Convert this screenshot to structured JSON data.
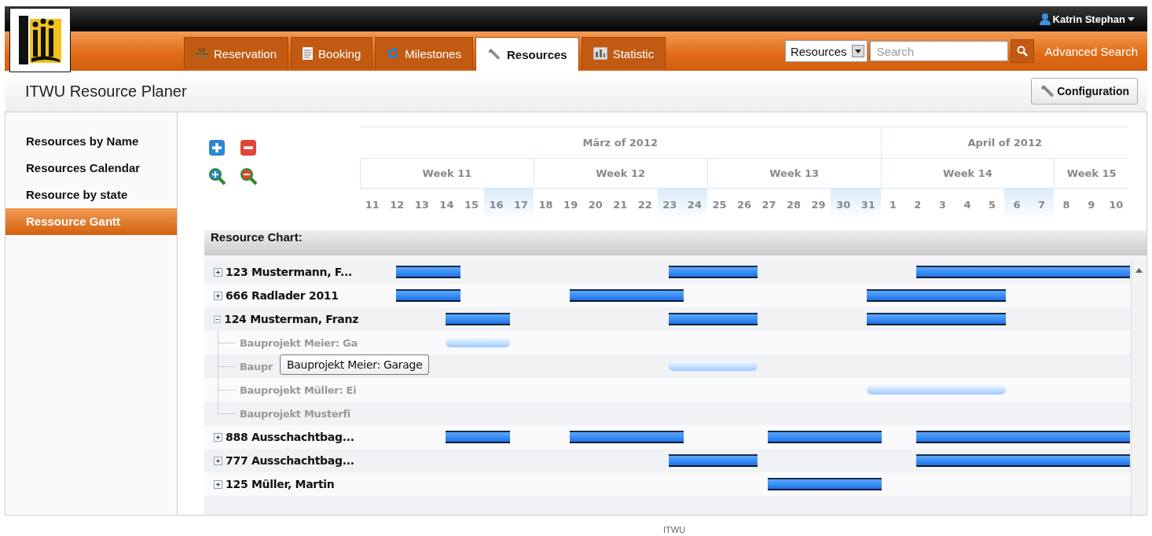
{
  "user": {
    "name": "Katrin Stephan"
  },
  "tabs": [
    {
      "label": "Reservation",
      "selected": false
    },
    {
      "label": "Booking",
      "selected": false
    },
    {
      "label": "Milestones",
      "selected": false
    },
    {
      "label": "Resources",
      "selected": true
    },
    {
      "label": "Statistic",
      "selected": false
    }
  ],
  "search": {
    "scope": "Resources",
    "placeholder": "Search",
    "advanced_link": "Advanced Search"
  },
  "page_title": "ITWU Resource Planer",
  "configuration_button": "Configuration",
  "sidebar": {
    "items": [
      {
        "label": "Resources by Name",
        "selected": false
      },
      {
        "label": "Resources Calendar",
        "selected": false
      },
      {
        "label": "Resource by state",
        "selected": false
      },
      {
        "label": "Ressource Gantt",
        "selected": true
      }
    ]
  },
  "gantt": {
    "months": [
      "März of 2012",
      "April of 2012"
    ],
    "weeks": [
      "Week 11",
      "Week 12",
      "Week 13",
      "Week 14",
      "Week 15"
    ],
    "days": [
      {
        "label": "11",
        "weekend": false
      },
      {
        "label": "12",
        "weekend": false
      },
      {
        "label": "13",
        "weekend": false
      },
      {
        "label": "14",
        "weekend": false
      },
      {
        "label": "15",
        "weekend": false
      },
      {
        "label": "16",
        "weekend": true
      },
      {
        "label": "17",
        "weekend": true
      },
      {
        "label": "18",
        "weekend": false
      },
      {
        "label": "19",
        "weekend": false
      },
      {
        "label": "20",
        "weekend": false
      },
      {
        "label": "21",
        "weekend": false
      },
      {
        "label": "22",
        "weekend": false
      },
      {
        "label": "23",
        "weekend": true
      },
      {
        "label": "24",
        "weekend": true
      },
      {
        "label": "25",
        "weekend": false
      },
      {
        "label": "26",
        "weekend": false
      },
      {
        "label": "27",
        "weekend": false
      },
      {
        "label": "28",
        "weekend": false
      },
      {
        "label": "29",
        "weekend": false
      },
      {
        "label": "30",
        "weekend": true
      },
      {
        "label": "31",
        "weekend": true
      },
      {
        "label": "1",
        "weekend": false
      },
      {
        "label": "2",
        "weekend": false
      },
      {
        "label": "3",
        "weekend": false
      },
      {
        "label": "4",
        "weekend": false
      },
      {
        "label": "5",
        "weekend": false
      },
      {
        "label": "6",
        "weekend": true
      },
      {
        "label": "7",
        "weekend": true
      },
      {
        "label": "8",
        "weekend": false
      },
      {
        "label": "9",
        "weekend": false
      },
      {
        "label": "10",
        "weekend": false
      }
    ],
    "chart_title": "Resource Chart:",
    "rows": [
      {
        "label": "123 Mustermann, F...",
        "expanded": false
      },
      {
        "label": "666 Radlader 2011",
        "expanded": false
      },
      {
        "label": "124 Musterman, Franz",
        "expanded": true,
        "children": [
          {
            "label": "Bauprojekt Meier: Ga"
          },
          {
            "label": "Baupr"
          },
          {
            "label": "Bauprojekt Müller: Ei"
          },
          {
            "label": "Bauprojekt Musterfi"
          }
        ]
      },
      {
        "label": "888 Ausschachtbag...",
        "expanded": false
      },
      {
        "label": "777 Ausschachtbag...",
        "expanded": false
      },
      {
        "label": "125 Müller, Martin",
        "expanded": false
      }
    ],
    "tooltip": "Bauprojekt Meier: Garage"
  },
  "footer": "ITWU"
}
